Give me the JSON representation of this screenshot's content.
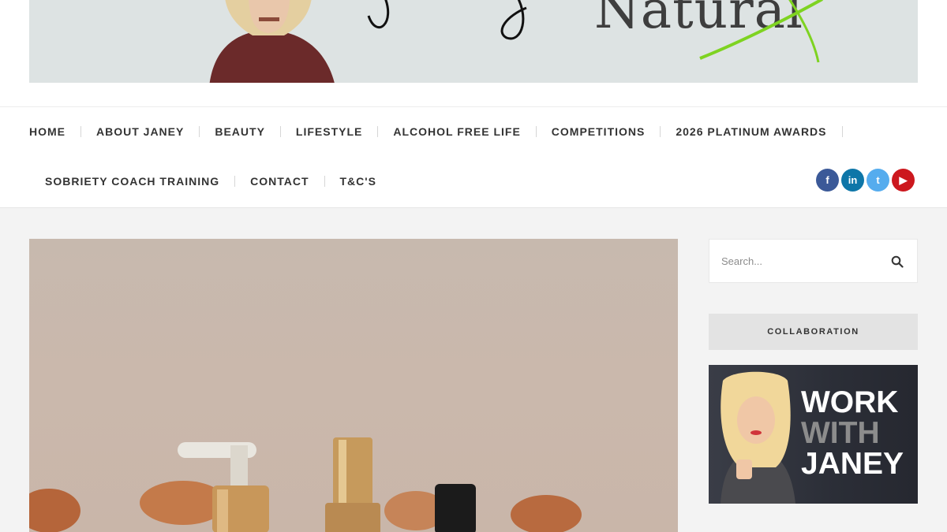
{
  "header": {
    "banner_title": "Natural"
  },
  "nav": {
    "row1": [
      "HOME",
      "ABOUT JANEY",
      "BEAUTY",
      "LIFESTYLE",
      "ALCOHOL FREE LIFE",
      "COMPETITIONS",
      "2026 PLATINUM AWARDS"
    ],
    "row2": [
      "SOBRIETY COACH TRAINING",
      "CONTACT",
      "T&C'S"
    ]
  },
  "social": {
    "icons": [
      "facebook-icon",
      "linkedin-icon",
      "twitter-icon",
      "youtube-icon"
    ],
    "facebook": "f",
    "linkedin": "in",
    "twitter": "t",
    "youtube": "▶",
    "colors": {
      "facebook": "#3b5998",
      "linkedin": "#0e76a8",
      "twitter": "#55acee",
      "youtube": "#cc181e"
    }
  },
  "sidebar": {
    "search_placeholder": "Search...",
    "widget_title": "COLLABORATION",
    "collab_line1": "WORK",
    "collab_line2": "WITH",
    "collab_line3": "JANEY"
  }
}
